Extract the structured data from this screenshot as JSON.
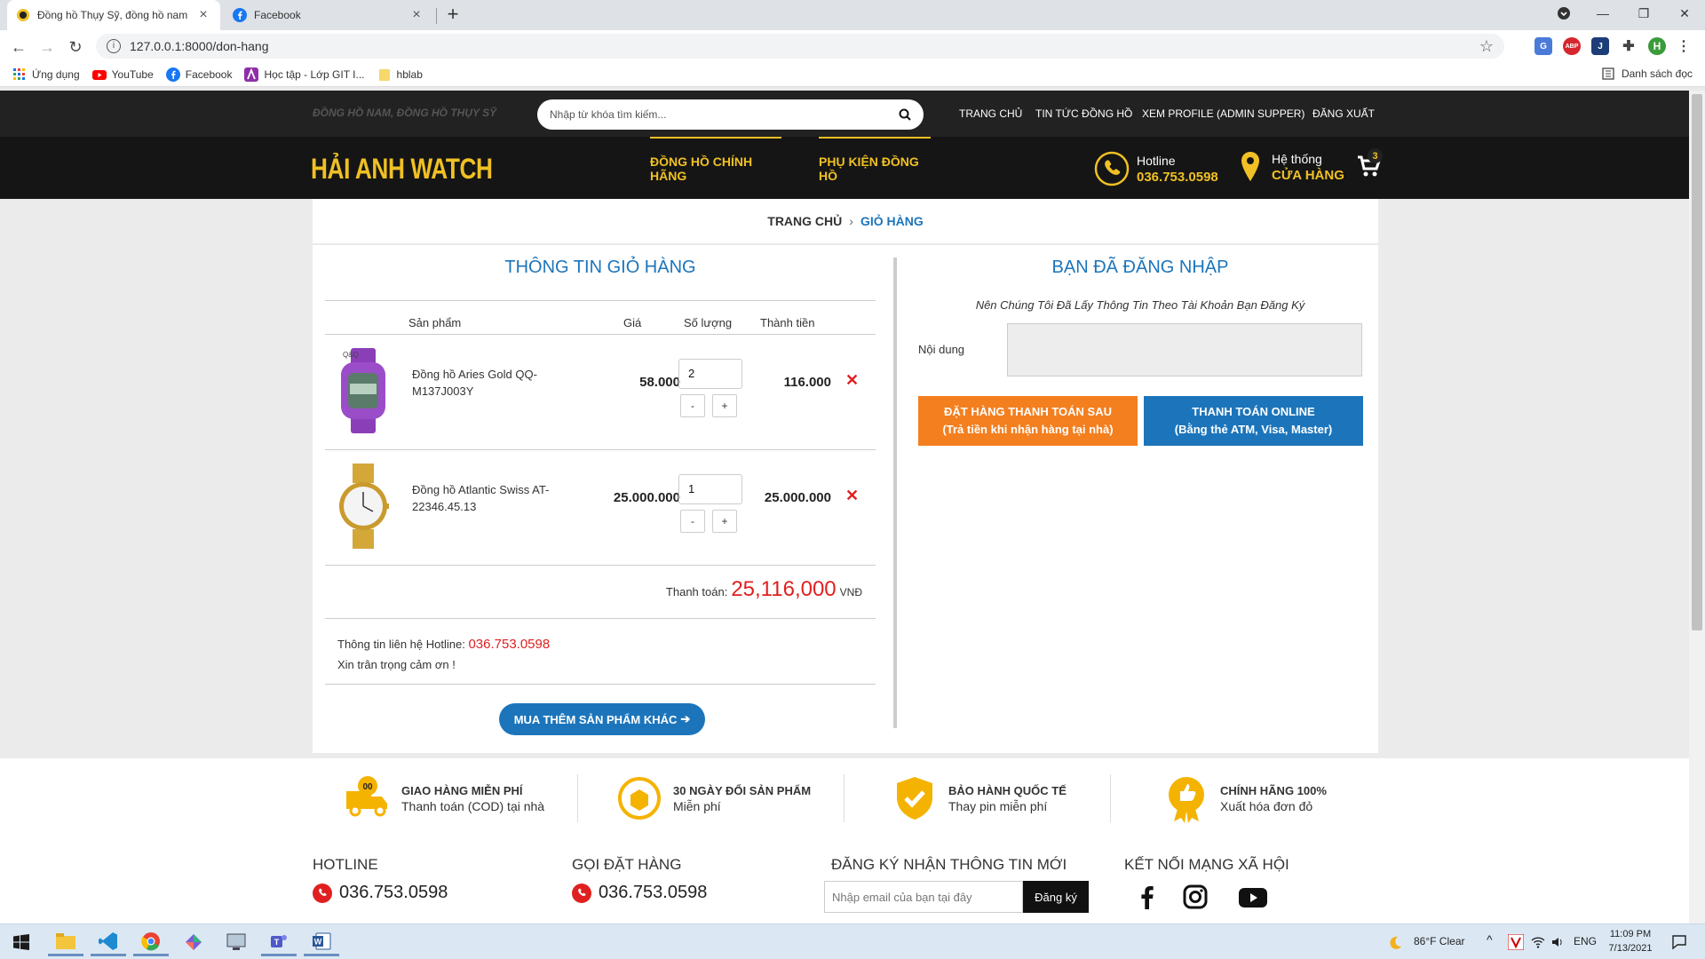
{
  "browser": {
    "tabs": [
      {
        "title": "Đồng hồ Thụy Sỹ, đồng hồ nam",
        "active": true
      },
      {
        "title": "Facebook",
        "active": false
      }
    ],
    "url": "127.0.0.1:8000/don-hang",
    "bookmarks": [
      "Ứng dụng",
      "YouTube",
      "Facebook",
      "Học tập - Lớp GIT I...",
      "hblab"
    ],
    "reading_list": "Danh sách đọc",
    "profile_initial": "H",
    "extensions": [
      "translate-icon",
      "abp-icon",
      "extension-j-icon",
      "puzzle-icon"
    ],
    "abp_label": "ABP"
  },
  "header": {
    "slogan": "ĐỒNG HỒ NAM, ĐỒNG HỒ THỤY SỸ",
    "search_placeholder": "Nhập từ khóa tìm kiếm...",
    "top_nav": [
      "TRANG CHỦ",
      "TIN TỨC ĐỒNG HỒ",
      "XEM PROFILE (ADMIN SUPPER)",
      "ĐĂNG XUẤT"
    ],
    "logo": "HẢI ANH WATCH",
    "main_nav": [
      "ĐỒNG HỒ CHÍNH HÃNG",
      "PHỤ KIỆN ĐỒNG HỒ"
    ],
    "hotline_label": "Hotline",
    "hotline_value": "036.753.0598",
    "stores_label": "Hệ thống",
    "stores_value": "CỬA HÀNG",
    "cart_count": "3",
    "accent_color": "#f0c024"
  },
  "breadcrumb": {
    "home": "TRANG CHỦ",
    "separator": "›",
    "current": "GIỎ HÀNG"
  },
  "cart": {
    "title": "THÔNG TIN GIỎ HÀNG",
    "columns": [
      "Sản phẩm",
      "Giá",
      "Số lượng",
      "Thành tiền"
    ],
    "items": [
      {
        "name": "Đồng hồ Aries Gold QQ-M137J003Y",
        "price": "58.000",
        "qty": "2",
        "total": "116.000"
      },
      {
        "name": "Đồng hồ Atlantic Swiss AT-22346.45.13",
        "price": "25.000.000",
        "qty": "1",
        "total": "25.000.000"
      }
    ],
    "minus": "-",
    "plus": "+",
    "remove_symbol": "✕",
    "sum_label": "Thanh toán:",
    "sum_value": "25,116,000",
    "sum_currency": "VNĐ",
    "contact_label": "Thông tin liên hệ Hotline:",
    "contact_hotline": "036.753.0598",
    "thanks": "Xin trân trọng cảm ơn !",
    "more_button": "MUA THÊM SẢN PHẨM KHÁC",
    "more_arrow": "➔"
  },
  "checkout": {
    "title": "BẠN ĐÃ ĐĂNG NHẬP",
    "note": "Nên Chúng Tôi Đã Lấy Thông Tin Theo Tài Khoản Bạn Đăng Ký",
    "content_label": "Nội dung",
    "pay_later_title": "ĐẶT HÀNG THANH TOÁN SAU",
    "pay_later_sub": "(Trả tiền khi nhận hàng tại nhà)",
    "pay_online_title": "THANH TOÁN ONLINE",
    "pay_online_sub": "(Bằng thẻ ATM, Visa, Master)",
    "pay_later_color": "#f47f1f",
    "pay_online_color": "#1c75bb"
  },
  "features": [
    {
      "title": "GIAO HÀNG MIỄN PHÍ",
      "sub": "Thanh toán (COD) tại nhà",
      "icon": "truck-icon"
    },
    {
      "title": "30 NGÀY ĐỔI SẢN PHẨM",
      "sub": "Miễn phí",
      "icon": "box-return-icon"
    },
    {
      "title": "BẢO HÀNH QUỐC TẾ",
      "sub": "Thay pin miễn phí",
      "icon": "shield-check-icon"
    },
    {
      "title": "CHÍNH HÃNG 100%",
      "sub": "Xuất hóa đơn đỏ",
      "icon": "medal-thumb-icon"
    }
  ],
  "footer": {
    "hotline_title": "HOTLINE",
    "hotline_value": "036.753.0598",
    "order_title": "GỌI ĐẶT HÀNG",
    "order_value": "036.753.0598",
    "newsletter_title": "ĐĂNG KÝ NHẬN THÔNG TIN MỚI",
    "email_placeholder": "Nhập email của bạn tại đây",
    "register_button": "Đăng ký",
    "social_title": "KẾT NỐI MẠNG XÃ HỘI",
    "social": [
      "facebook-icon",
      "instagram-icon",
      "youtube-icon"
    ]
  },
  "taskbar": {
    "apps": [
      "file-explorer-icon",
      "vscode-icon",
      "chrome-icon",
      "app-icon",
      "remote-desktop-icon",
      "teams-icon",
      "word-icon"
    ],
    "weather": "86°F  Clear",
    "lang": "ENG",
    "time": "11:09 PM",
    "date": "7/13/2021"
  }
}
